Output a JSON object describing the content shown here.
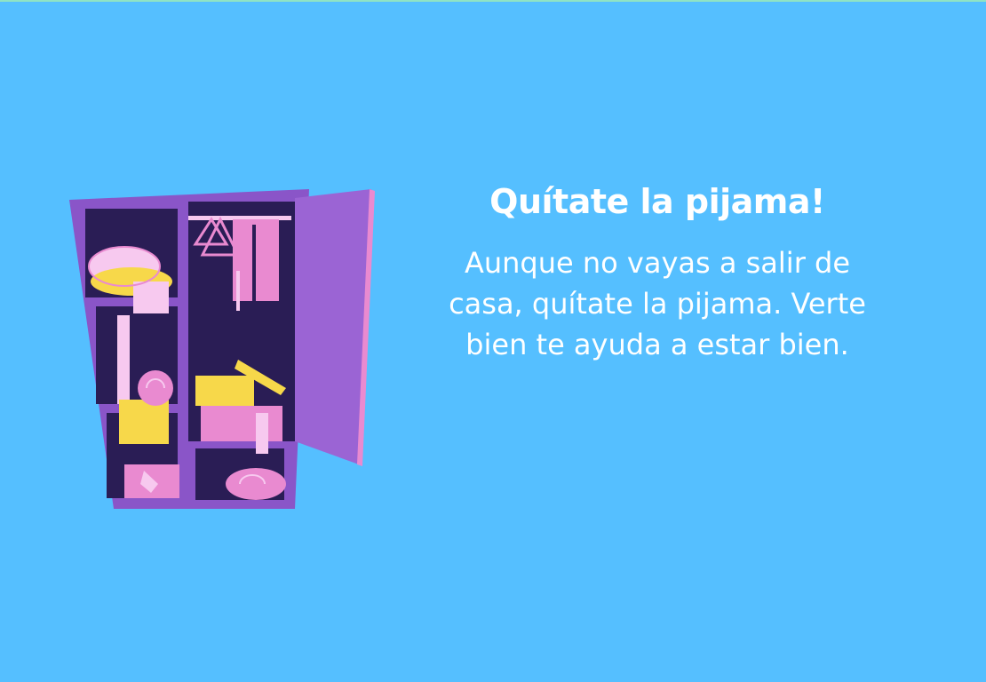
{
  "slide": {
    "title": "Quítate la pijama!",
    "body": "Aunque no vayas a salir de casa, quítate la pijama. Verte bien te ayuda a estar bien."
  },
  "illustration": {
    "icon": "wardrobe-illustration",
    "colors": {
      "background": "#55bfff",
      "cabinet": "#8a55c8",
      "interior": "#2a1d55",
      "door": "#9b64d4",
      "pink": "#e98ad0",
      "light_pink": "#f7c9ef",
      "yellow": "#f7d84a"
    }
  }
}
